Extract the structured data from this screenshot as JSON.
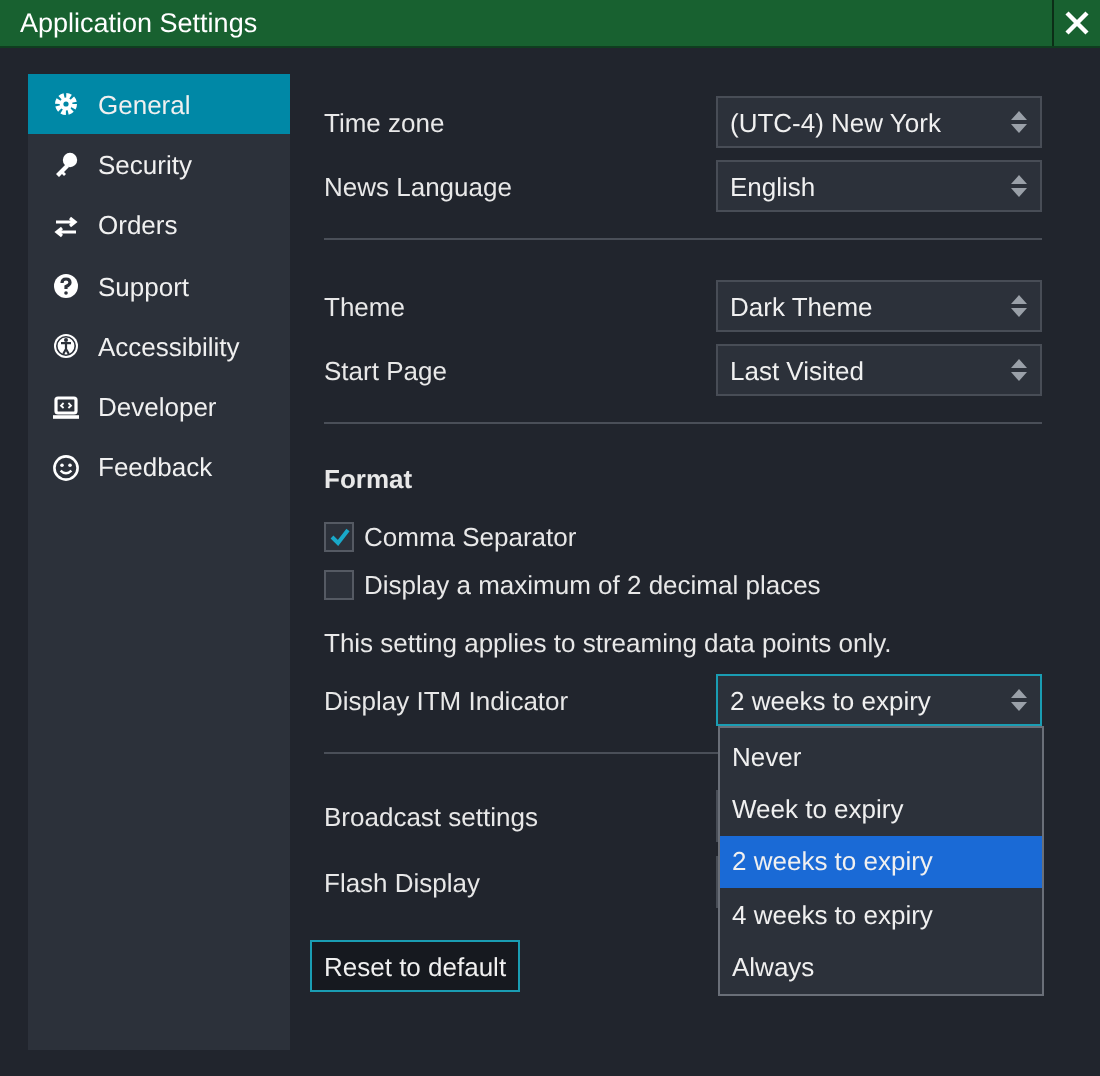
{
  "window": {
    "title": "Application Settings"
  },
  "sidebar": {
    "items": [
      {
        "label": "General",
        "selected": true
      },
      {
        "label": "Security",
        "selected": false
      },
      {
        "label": "Orders",
        "selected": false
      },
      {
        "label": "Support",
        "selected": false
      },
      {
        "label": "Accessibility",
        "selected": false
      },
      {
        "label": "Developer",
        "selected": false
      },
      {
        "label": "Feedback",
        "selected": false
      }
    ]
  },
  "general": {
    "locale_rows": [
      {
        "label": "Time zone",
        "value": "(UTC-4) New York"
      },
      {
        "label": "News Language",
        "value": "English"
      }
    ],
    "appearance_rows": [
      {
        "label": "Theme",
        "value": "Dark Theme"
      },
      {
        "label": "Start Page",
        "value": "Last Visited"
      }
    ],
    "format": {
      "heading": "Format",
      "checkboxes": [
        {
          "label": "Comma Separator",
          "checked": true
        },
        {
          "label": "Display a maximum of 2 decimal places",
          "checked": false
        }
      ],
      "note": "This setting applies to streaming data points only.",
      "itm_row": {
        "label": "Display ITM Indicator",
        "value": "2 weeks to expiry",
        "expanded": true,
        "options": [
          {
            "label": "Never",
            "selected": false
          },
          {
            "label": "Week to expiry",
            "selected": false
          },
          {
            "label": "2 weeks to expiry",
            "selected": true
          },
          {
            "label": "4 weeks to expiry",
            "selected": false
          },
          {
            "label": "Always",
            "selected": false
          }
        ]
      }
    },
    "display_rows": [
      {
        "label": "Broadcast settings"
      },
      {
        "label": "Flash Display"
      }
    ],
    "reset_button": "Reset to default"
  }
}
